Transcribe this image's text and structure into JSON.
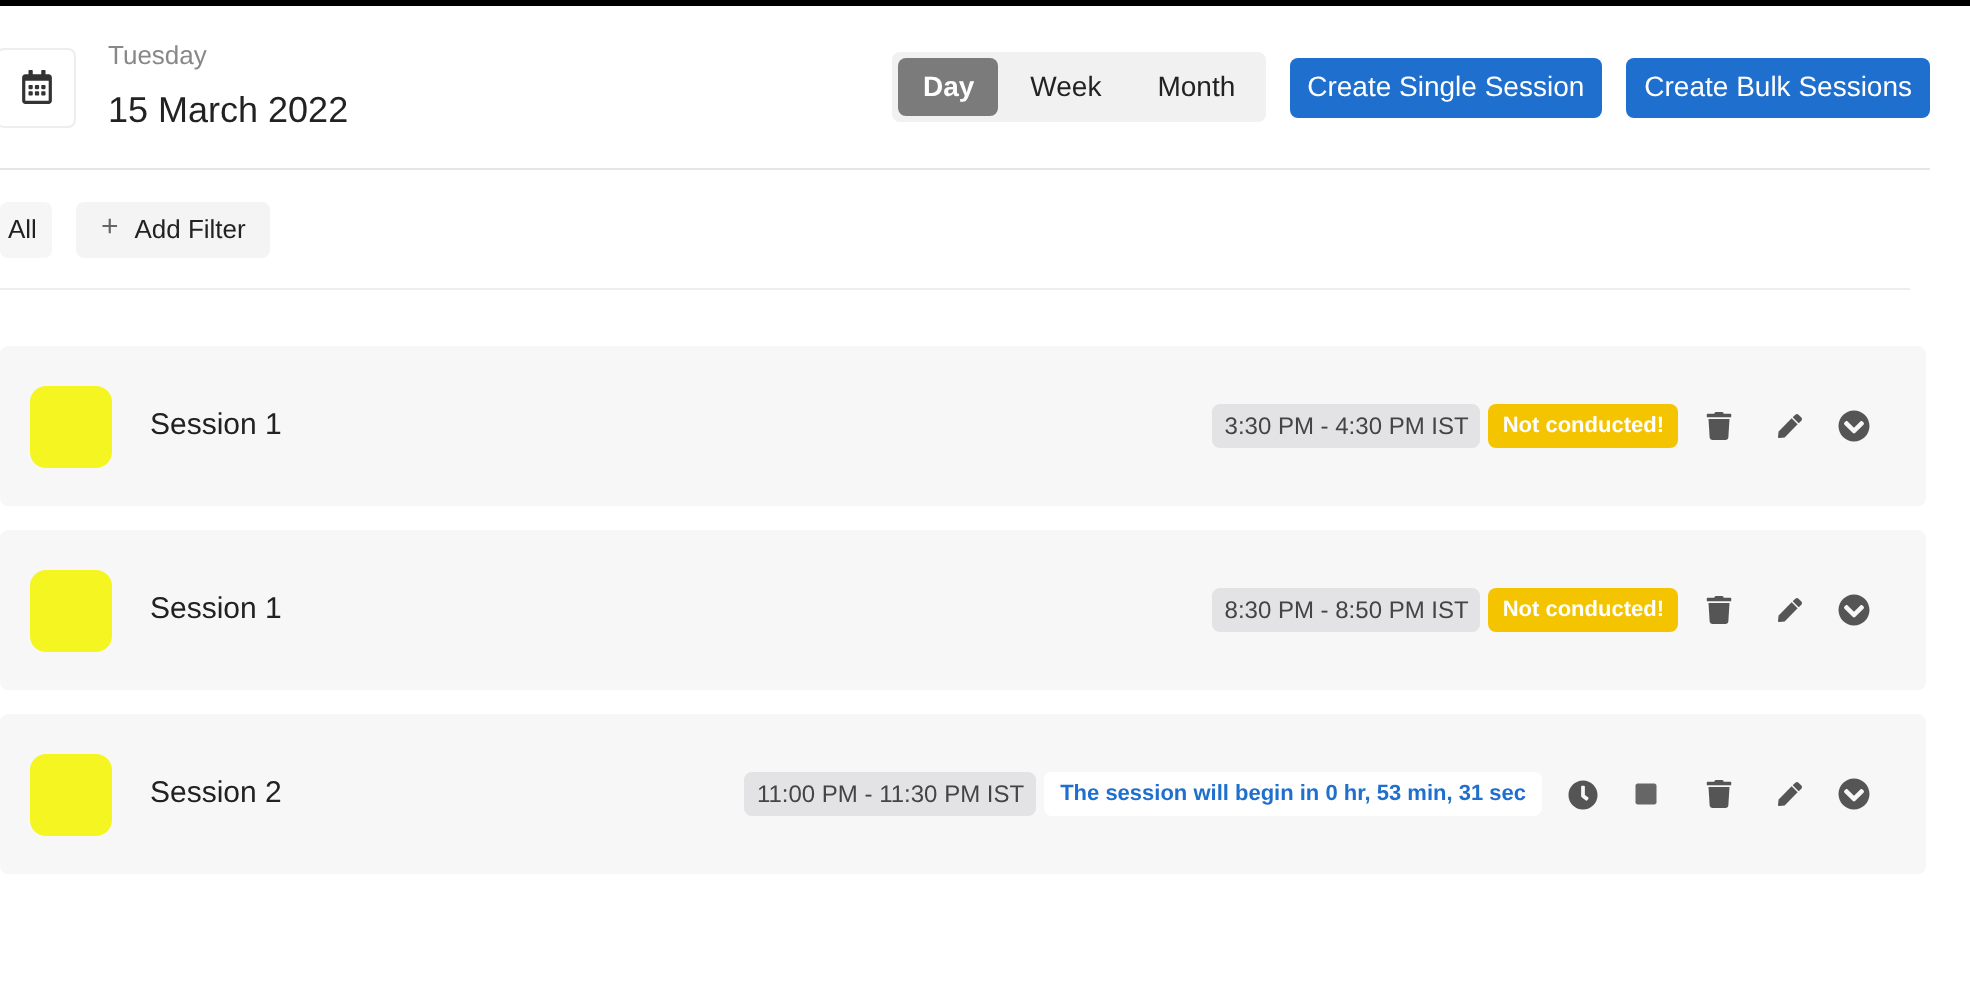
{
  "date": {
    "weekday": "Tuesday",
    "full": "15 March 2022"
  },
  "view_tabs": [
    {
      "label": "Day",
      "selected": true
    },
    {
      "label": "Week",
      "selected": false
    },
    {
      "label": "Month",
      "selected": false
    }
  ],
  "actions": [
    "Create Single Session",
    "Create Bulk Sessions"
  ],
  "filters": {
    "all": "All",
    "add": "Add Filter",
    "add_icon": "+"
  },
  "sessions": [
    {
      "name": "Session 1",
      "color": "#f5f522",
      "time": "3:30 PM - 4:30 PM IST",
      "kind": "not_conducted",
      "status": "Not conducted!"
    },
    {
      "name": "Session 1",
      "color": "#f5f522",
      "time": "8:30 PM - 8:50 PM IST",
      "kind": "not_conducted",
      "status": "Not conducted!"
    },
    {
      "name": "Session 2",
      "color": "#f5f522",
      "time": "11:00 PM - 11:30 PM IST",
      "kind": "upcoming",
      "status": "The session will begin in 0 hr, 53 min, 31 sec"
    }
  ]
}
